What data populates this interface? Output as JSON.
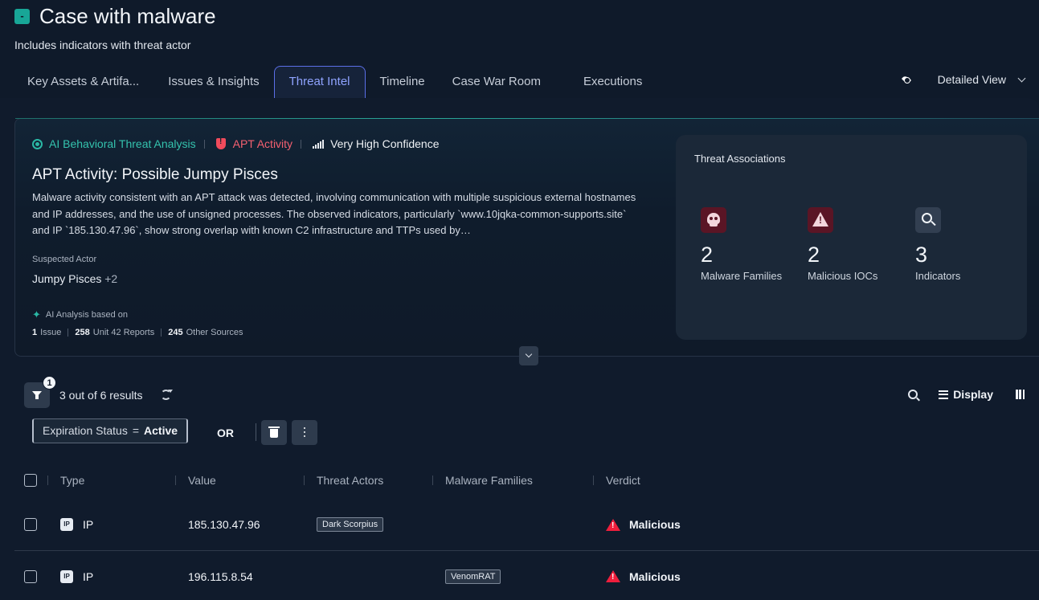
{
  "header": {
    "collapse_label": "-",
    "title": "Case with malware",
    "subtitle": "Includes indicators with threat actor"
  },
  "tabs": [
    {
      "label": "Key Assets & Artifa...",
      "active": false
    },
    {
      "label": "Issues & Insights",
      "active": false
    },
    {
      "label": "Threat Intel",
      "active": true
    },
    {
      "label": "Timeline",
      "active": false
    },
    {
      "label": "Case War Room",
      "active": false
    },
    {
      "label": "Executions",
      "active": false
    }
  ],
  "view": {
    "selected": "Detailed View",
    "icon": "eye-icon"
  },
  "threat_card": {
    "ai_label": "AI Behavioral Threat Analysis",
    "activity_label": "APT Activity",
    "confidence_label": "Very High Confidence",
    "title": "APT Activity: Possible Jumpy Pisces",
    "description": "Malware activity consistent with an APT attack was detected, involving communication with multiple suspicious external hostnames and IP addresses, and the use of unsigned processes. The observed indicators, particularly `www.10jqka-common-supports.site` and IP `185.130.47.96`, show strong overlap with known C2 infrastructure and TTPs used by…",
    "suspected_actor_label": "Suspected Actor",
    "suspected_actor": "Jumpy Pisces",
    "suspected_actor_more": "+2",
    "basis_label": "AI Analysis based on",
    "stats": [
      {
        "count": "1",
        "label": "Issue"
      },
      {
        "count": "258",
        "label": "Unit 42 Reports"
      },
      {
        "count": "245",
        "label": "Other Sources"
      }
    ]
  },
  "associations": {
    "title": "Threat Associations",
    "items": [
      {
        "count": "2",
        "label": "Malware Families",
        "icon": "skull-icon"
      },
      {
        "count": "2",
        "label": "Malicious IOCs",
        "icon": "warning-icon"
      },
      {
        "count": "3",
        "label": "Indicators",
        "icon": "search-icon"
      }
    ]
  },
  "toolbar": {
    "filter_count": "1",
    "results": "3 out of 6 results",
    "display_label": "Display"
  },
  "filter": {
    "field": "Expiration Status",
    "operator": "=",
    "value": "Active",
    "or_label": "OR"
  },
  "table": {
    "columns": [
      "Type",
      "Value",
      "Threat Actors",
      "Malware Families",
      "Verdict"
    ],
    "rows": [
      {
        "type": "IP",
        "type_icon": "IP",
        "value": "185.130.47.96",
        "threat_actors": "Dark Scorpius",
        "malware_families": "",
        "verdict": "Malicious"
      },
      {
        "type": "IP",
        "type_icon": "IP",
        "value": "196.115.8.54",
        "threat_actors": "",
        "malware_families": "VenomRAT",
        "verdict": "Malicious"
      }
    ]
  },
  "colors": {
    "accent": "#8fa3ff",
    "ai_green": "#34c3ae",
    "apt_red": "#f46070",
    "malicious_red": "#ee1e3c"
  }
}
